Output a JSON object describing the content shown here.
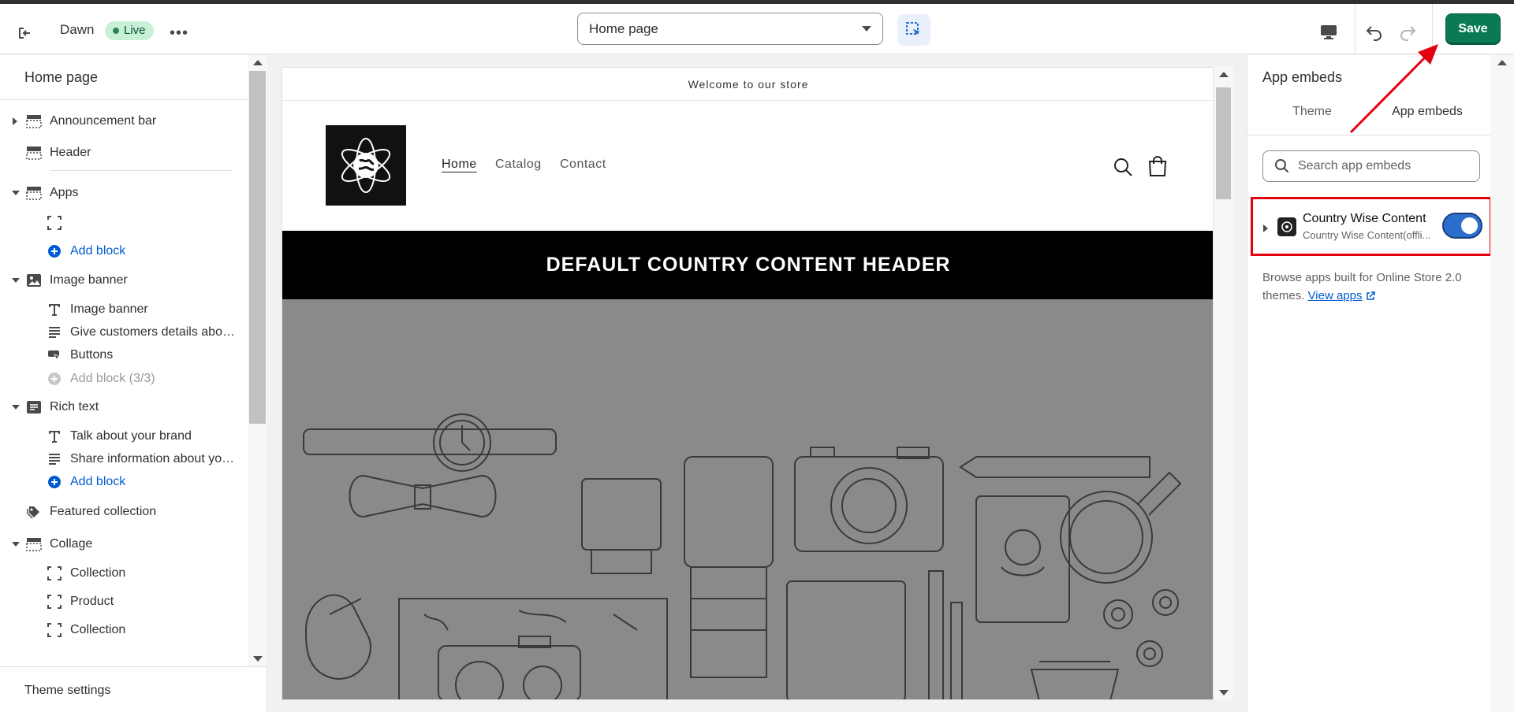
{
  "topbar": {
    "theme_name": "Dawn",
    "live_badge": "Live",
    "page_select_value": "Home page",
    "save_label": "Save"
  },
  "sidebar": {
    "title": "Home page",
    "sections": [
      {
        "label": "Announcement bar",
        "icon": "section-icon",
        "expanded": false
      },
      {
        "label": "Header",
        "icon": "header-icon"
      },
      {
        "label": "Apps",
        "icon": "section-icon",
        "expanded": true
      },
      {
        "label": "Add block",
        "icon": "plus-circle-icon"
      },
      {
        "label": "Image banner",
        "icon": "image-icon",
        "expanded": true
      },
      {
        "label": "Image banner",
        "icon": "text-icon"
      },
      {
        "label": "Give customers details about...",
        "icon": "paragraph-icon"
      },
      {
        "label": "Buttons",
        "icon": "button-icon"
      },
      {
        "label": "Add block (3/3)",
        "icon": "plus-circle-icon"
      },
      {
        "label": "Rich text",
        "icon": "rich-text-icon",
        "expanded": true
      },
      {
        "label": "Talk about your brand",
        "icon": "text-icon"
      },
      {
        "label": "Share information about you...",
        "icon": "paragraph-icon"
      },
      {
        "label": "Add block",
        "icon": "plus-circle-icon"
      },
      {
        "label": "Featured collection",
        "icon": "tag-icon"
      },
      {
        "label": "Collage",
        "icon": "section-icon",
        "expanded": true
      },
      {
        "label": "Collection",
        "icon": "dashed-square-icon"
      },
      {
        "label": "Product",
        "icon": "dashed-square-icon"
      },
      {
        "label": "Collection",
        "icon": "dashed-square-icon"
      }
    ],
    "footer": "Theme settings"
  },
  "preview": {
    "announcement": "Welcome to our store",
    "nav": [
      "Home",
      "Catalog",
      "Contact"
    ],
    "band_heading": "DEFAULT COUNTRY CONTENT HEADER"
  },
  "right_panel": {
    "title": "App embeds",
    "tabs": [
      "Theme",
      "App embeds"
    ],
    "active_tab": "App embeds",
    "search_placeholder": "Search app embeds",
    "embed": {
      "title": "Country Wise Content",
      "subtitle": "Country Wise Content(offli...",
      "enabled": true
    },
    "browse_text": "Browse apps built for Online Store 2.0 themes.",
    "browse_link": "View apps"
  },
  "colors": {
    "save": "#0a7a55",
    "toggle_on": "#2c6ecb",
    "highlight": "#e5000f",
    "link": "#005bd3"
  }
}
